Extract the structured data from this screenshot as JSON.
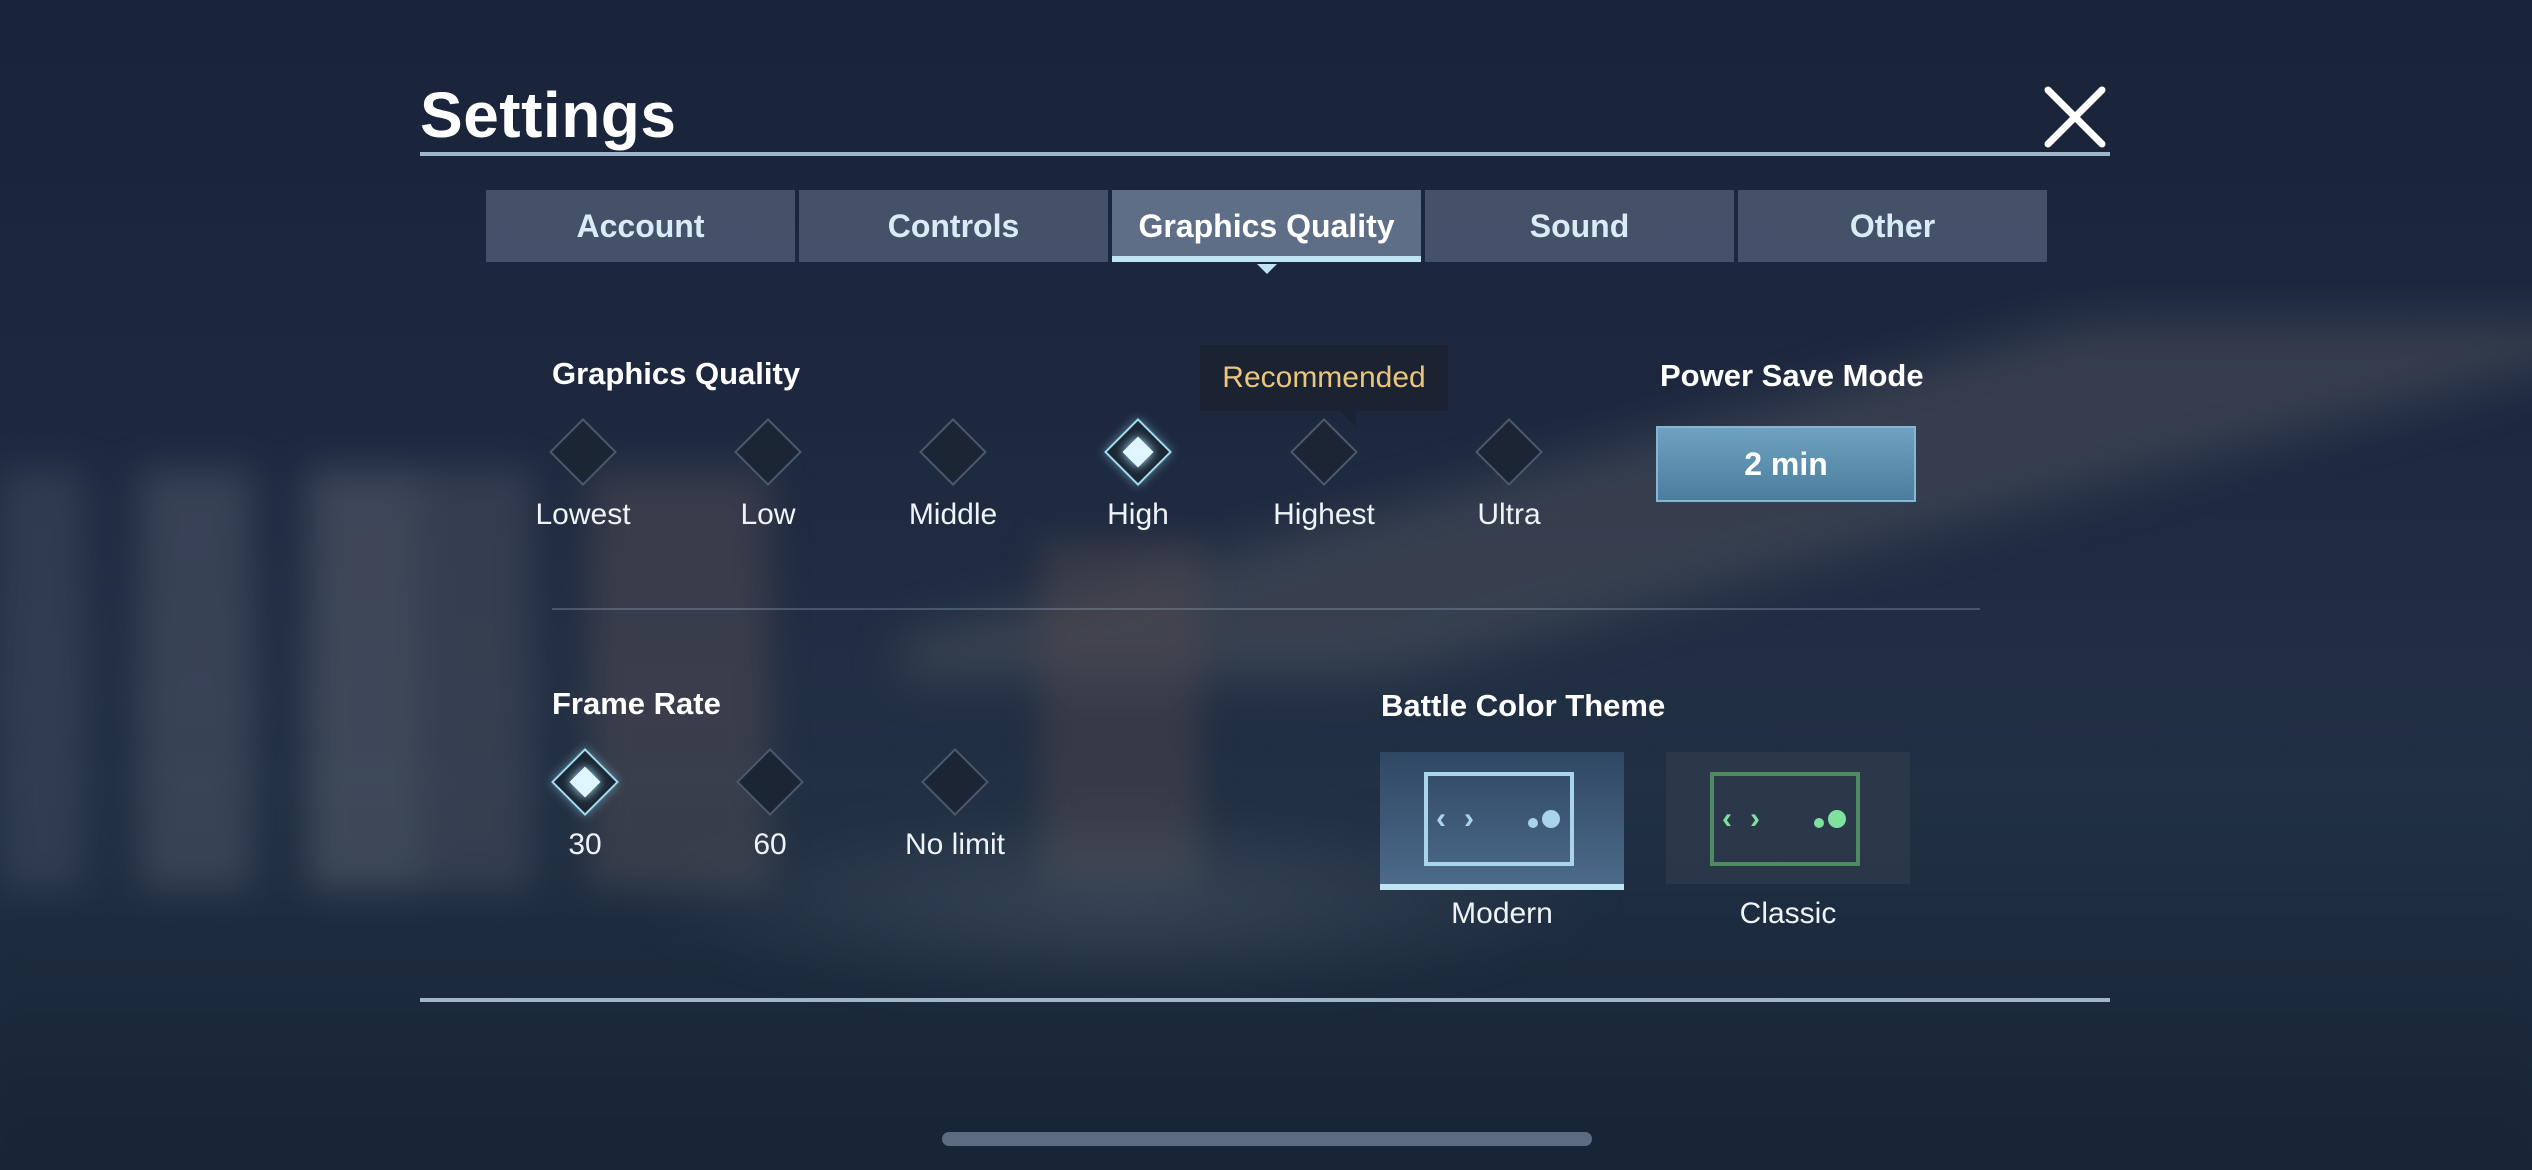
{
  "header": {
    "title": "Settings",
    "close_icon": "close-x-icon"
  },
  "tabs": [
    {
      "label": "Account",
      "active": false
    },
    {
      "label": "Controls",
      "active": false
    },
    {
      "label": "Graphics Quality",
      "active": true
    },
    {
      "label": "Sound",
      "active": false
    },
    {
      "label": "Other",
      "active": false
    }
  ],
  "graphics": {
    "label": "Graphics Quality",
    "options": [
      "Lowest",
      "Low",
      "Middle",
      "High",
      "Highest",
      "Ultra"
    ],
    "selected": "High",
    "recommended_tooltip": "Recommended",
    "recommended_option": "Highest"
  },
  "power_save": {
    "label": "Power Save Mode",
    "value": "2 min"
  },
  "frame_rate": {
    "label": "Frame Rate",
    "options": [
      "30",
      "60",
      "No limit"
    ],
    "selected": "30"
  },
  "color_theme": {
    "label": "Battle Color Theme",
    "options": [
      {
        "label": "Modern",
        "selected": true,
        "accent": "#a9d4ea"
      },
      {
        "label": "Classic",
        "selected": false,
        "accent": "#7fe0a0"
      }
    ]
  },
  "colors": {
    "tooltip_text": "#e9c67a",
    "active_tab_underline": "#bfe4f2"
  }
}
